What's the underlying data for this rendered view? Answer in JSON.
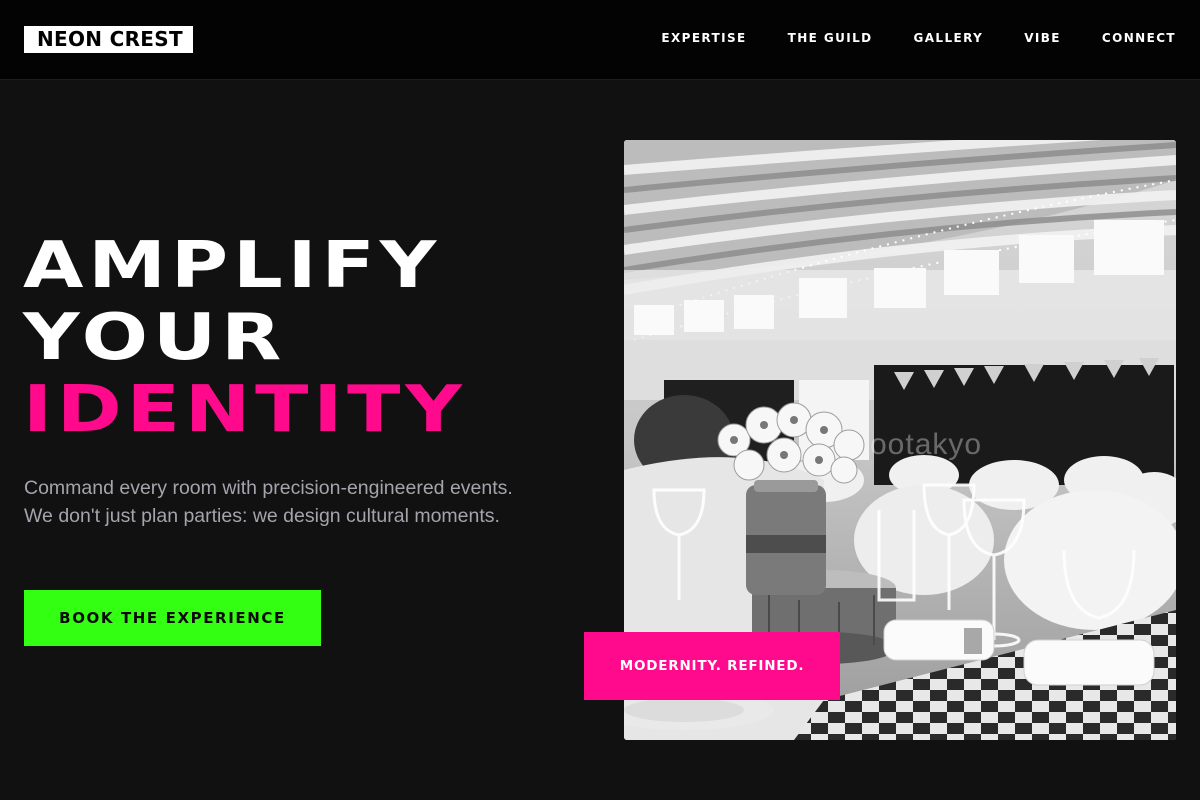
{
  "brand": {
    "logo_text": "NEON CREST"
  },
  "nav": {
    "items": [
      {
        "label": "EXPERTISE"
      },
      {
        "label": "THE GUILD"
      },
      {
        "label": "GALLERY"
      },
      {
        "label": "VIBE"
      },
      {
        "label": "CONNECT"
      }
    ]
  },
  "hero": {
    "title_line_1": "AMPLIFY",
    "title_line_2": "YOUR",
    "title_line_3": "IDENTITY",
    "description": "Command every room with precision-engineered events. We don't just plan parties: we design cultural moments.",
    "cta_label": "BOOK THE EXPERIENCE"
  },
  "image": {
    "alt": "",
    "watermark": "ootakyo",
    "badge_text": "MODERNITY. REFINED."
  },
  "colors": {
    "background": "#111111",
    "nav_background": "#030303",
    "accent_pink": "#ff0a8c",
    "accent_green": "#33ff12",
    "muted_text": "#a4a4ac"
  }
}
